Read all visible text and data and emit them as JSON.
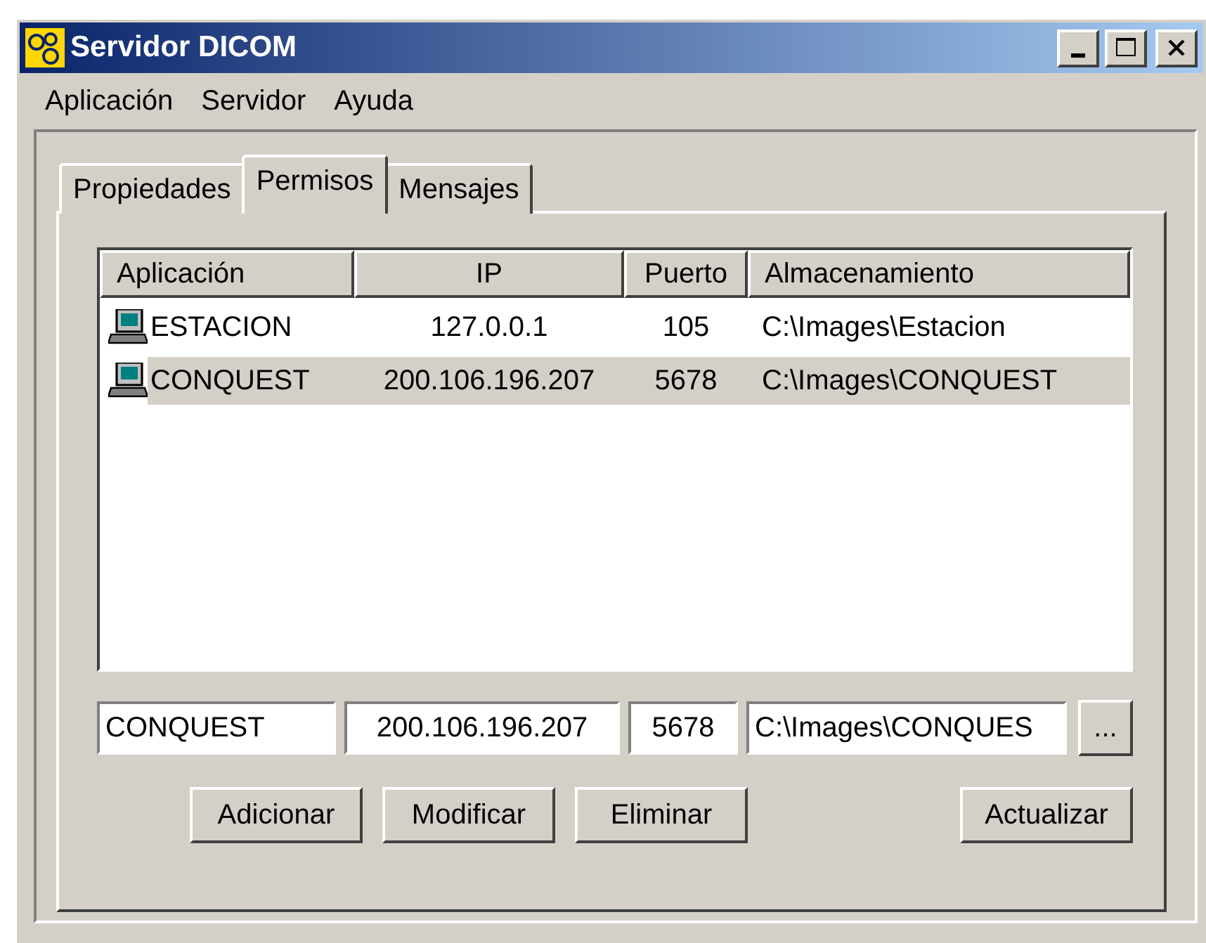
{
  "window": {
    "title": "Servidor DICOM"
  },
  "menu": [
    "Aplicación",
    "Servidor",
    "Ayuda"
  ],
  "tabs": [
    {
      "label": "Propiedades",
      "selected": false
    },
    {
      "label": "Permisos",
      "selected": true
    },
    {
      "label": "Mensajes",
      "selected": false
    }
  ],
  "table": {
    "columns": [
      "Aplicación",
      "IP",
      "Puerto",
      "Almacenamiento"
    ],
    "rows": [
      {
        "cells": [
          "ESTACION",
          "127.0.0.1",
          "105",
          "C:\\Images\\Estacion"
        ],
        "selected": false
      },
      {
        "cells": [
          "CONQUEST",
          "200.106.196.207",
          "5678",
          "C:\\Images\\CONQUEST"
        ],
        "selected": true
      }
    ]
  },
  "fields": [
    "CONQUEST",
    "200.106.196.207",
    "5678",
    "C:\\Images\\CONQUES"
  ],
  "browse_button": "...",
  "buttons": [
    "Adicionar",
    "Modificar",
    "Eliminar"
  ],
  "refresh_button": "Actualizar"
}
